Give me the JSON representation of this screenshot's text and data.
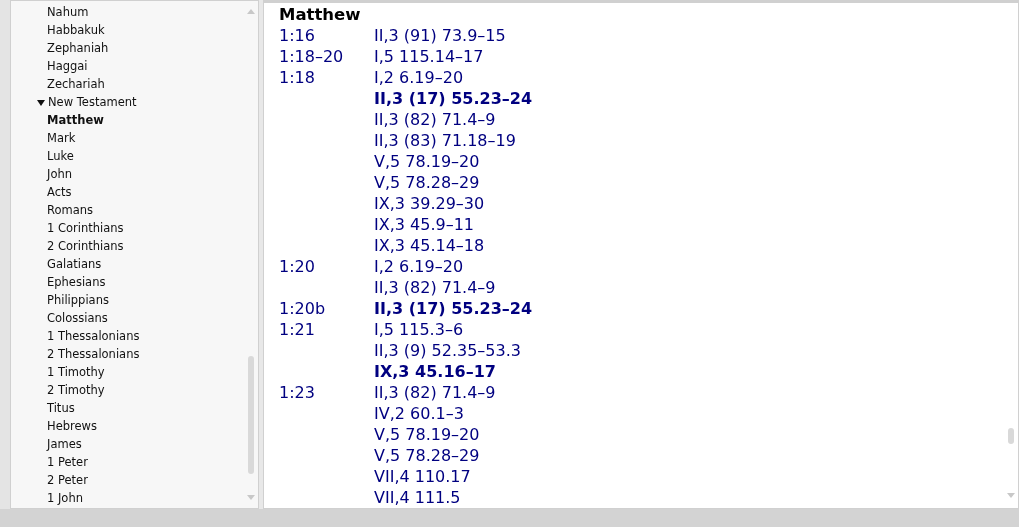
{
  "sidebar": {
    "items": [
      {
        "label": "Nahum",
        "selected": false
      },
      {
        "label": "Habbakuk",
        "selected": false
      },
      {
        "label": "Zephaniah",
        "selected": false
      },
      {
        "label": "Haggai",
        "selected": false
      },
      {
        "label": "Zechariah",
        "selected": false
      },
      {
        "label": "New Testament",
        "selected": false,
        "expanded": true,
        "children": [
          {
            "label": "Matthew",
            "selected": true
          },
          {
            "label": "Mark",
            "selected": false
          },
          {
            "label": "Luke",
            "selected": false
          },
          {
            "label": "John",
            "selected": false
          },
          {
            "label": "Acts",
            "selected": false
          },
          {
            "label": "Romans",
            "selected": false
          },
          {
            "label": "1 Corinthians",
            "selected": false
          },
          {
            "label": "2 Corinthians",
            "selected": false
          },
          {
            "label": "Galatians",
            "selected": false
          },
          {
            "label": "Ephesians",
            "selected": false
          },
          {
            "label": "Philippians",
            "selected": false
          },
          {
            "label": "Colossians",
            "selected": false
          },
          {
            "label": "1 Thessalonians",
            "selected": false
          },
          {
            "label": "2 Thessalonians",
            "selected": false
          },
          {
            "label": "1 Timothy",
            "selected": false
          },
          {
            "label": "2 Timothy",
            "selected": false
          },
          {
            "label": "Titus",
            "selected": false
          },
          {
            "label": "Hebrews",
            "selected": false
          },
          {
            "label": "James",
            "selected": false
          },
          {
            "label": "1 Peter",
            "selected": false
          },
          {
            "label": "2 Peter",
            "selected": false
          },
          {
            "label": "1 John",
            "selected": false
          }
        ]
      }
    ]
  },
  "index": {
    "title": "Matthew",
    "rows": [
      {
        "verse": "1:16",
        "refs": [
          {
            "text": "II,3 (91) 73.9–15",
            "emphasized": false
          }
        ]
      },
      {
        "verse": "1:18–20",
        "refs": [
          {
            "text": "I,5 115.14–17",
            "emphasized": false
          }
        ]
      },
      {
        "verse": "1:18",
        "refs": [
          {
            "text": "I,2 6.19–20",
            "emphasized": false
          },
          {
            "text": "II,3 (17) 55.23–24",
            "emphasized": true
          },
          {
            "text": "II,3 (82) 71.4–9",
            "emphasized": false
          },
          {
            "text": "II,3 (83) 71.18–19",
            "emphasized": false
          },
          {
            "text": "V,5 78.19–20",
            "emphasized": false
          },
          {
            "text": "V,5 78.28–29",
            "emphasized": false
          },
          {
            "text": "IX,3 39.29–30",
            "emphasized": false
          },
          {
            "text": "IX,3 45.9–11",
            "emphasized": false
          },
          {
            "text": "IX,3 45.14–18",
            "emphasized": false
          }
        ]
      },
      {
        "verse": "1:20",
        "refs": [
          {
            "text": "I,2 6.19–20",
            "emphasized": false
          },
          {
            "text": "II,3 (82) 71.4–9",
            "emphasized": false
          }
        ]
      },
      {
        "verse": "1:20b",
        "refs": [
          {
            "text": "II,3 (17) 55.23–24",
            "emphasized": true
          }
        ]
      },
      {
        "verse": "1:21",
        "refs": [
          {
            "text": "I,5 115.3–6",
            "emphasized": false
          },
          {
            "text": "II,3 (9) 52.35–53.3",
            "emphasized": false
          },
          {
            "text": "IX,3 45.16–17",
            "emphasized": true
          }
        ]
      },
      {
        "verse": "1:23",
        "refs": [
          {
            "text": "II,3 (82) 71.4–9",
            "emphasized": false
          },
          {
            "text": "IV,2 60.1–3",
            "emphasized": false
          },
          {
            "text": "V,5 78.19–20",
            "emphasized": false
          },
          {
            "text": "V,5 78.28–29",
            "emphasized": false
          },
          {
            "text": "VII,4 110.17",
            "emphasized": false
          },
          {
            "text": "VII,4 111.5",
            "emphasized": false
          }
        ]
      }
    ]
  }
}
